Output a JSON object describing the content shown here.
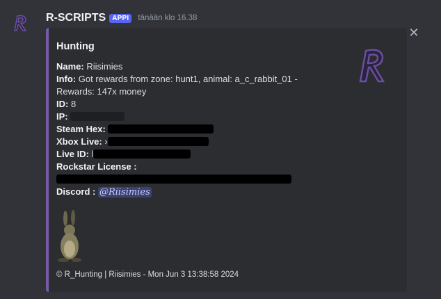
{
  "message": {
    "username": "R-SCRIPTS",
    "app_tag": "APPI",
    "timestamp": "tänään klo 16.38",
    "avatar_icon": "r-scripts-logo-icon"
  },
  "embed": {
    "accent_color": "#7a5aa6",
    "title": "Hunting",
    "thumbnail_icon": "r-scripts-logo-icon",
    "fields": {
      "name_label": "Name:",
      "name_value": "Riisimies",
      "info_label": "Info:",
      "info_value": "Got rewards from zone: hunt1, animal: a_c_rabbit_01 - Rewards: 147x money",
      "id_label": "ID:",
      "id_value": "8",
      "ip_label": "IP:",
      "steam_label": "Steam Hex:",
      "xbox_label": "Xbox Live:",
      "xbox_partial": "›",
      "liveid_label": "Live ID:",
      "liveid_partial": "l",
      "rockstar_label": "Rockstar License :",
      "discord_label": "Discord :",
      "discord_mention": "@Riisimies"
    },
    "image_icon": "rabbit-image",
    "footer": "© R_Hunting | Riisimies - Mon Jun  3 13:38:58 2024"
  },
  "close_icon": "close-icon"
}
